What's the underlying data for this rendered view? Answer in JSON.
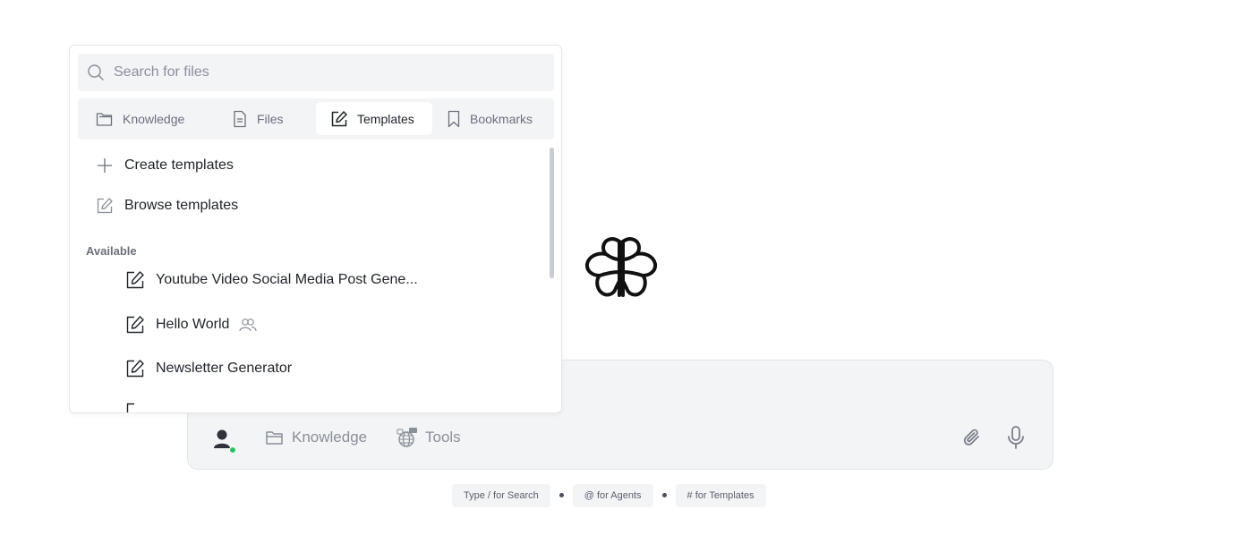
{
  "dropdown": {
    "search": {
      "placeholder": "Search for files",
      "value": ""
    },
    "tabs": [
      {
        "label": "Knowledge",
        "icon": "folder-icon",
        "active": false
      },
      {
        "label": "Files",
        "icon": "file-icon",
        "active": false
      },
      {
        "label": "Templates",
        "icon": "edit-icon",
        "active": true
      },
      {
        "label": "Bookmarks",
        "icon": "bookmark-icon",
        "active": false
      }
    ],
    "actions": [
      {
        "label": "Create templates",
        "icon": "plus-icon"
      },
      {
        "label": "Browse templates",
        "icon": "edit-icon"
      }
    ],
    "section_label": "Available",
    "templates": [
      {
        "label": "Youtube Video Social Media Post Gene...",
        "icon": "edit-icon",
        "shared": false
      },
      {
        "label": "Hello World",
        "icon": "edit-icon",
        "shared": true
      },
      {
        "label": "Newsletter Generator",
        "icon": "edit-icon",
        "shared": false
      }
    ]
  },
  "composer": {
    "knowledge_label": "Knowledge",
    "tools_label": "Tools",
    "status_color": "#22c55e"
  },
  "hints": [
    "Type / for Search",
    "@ for Agents",
    "# for Templates"
  ]
}
